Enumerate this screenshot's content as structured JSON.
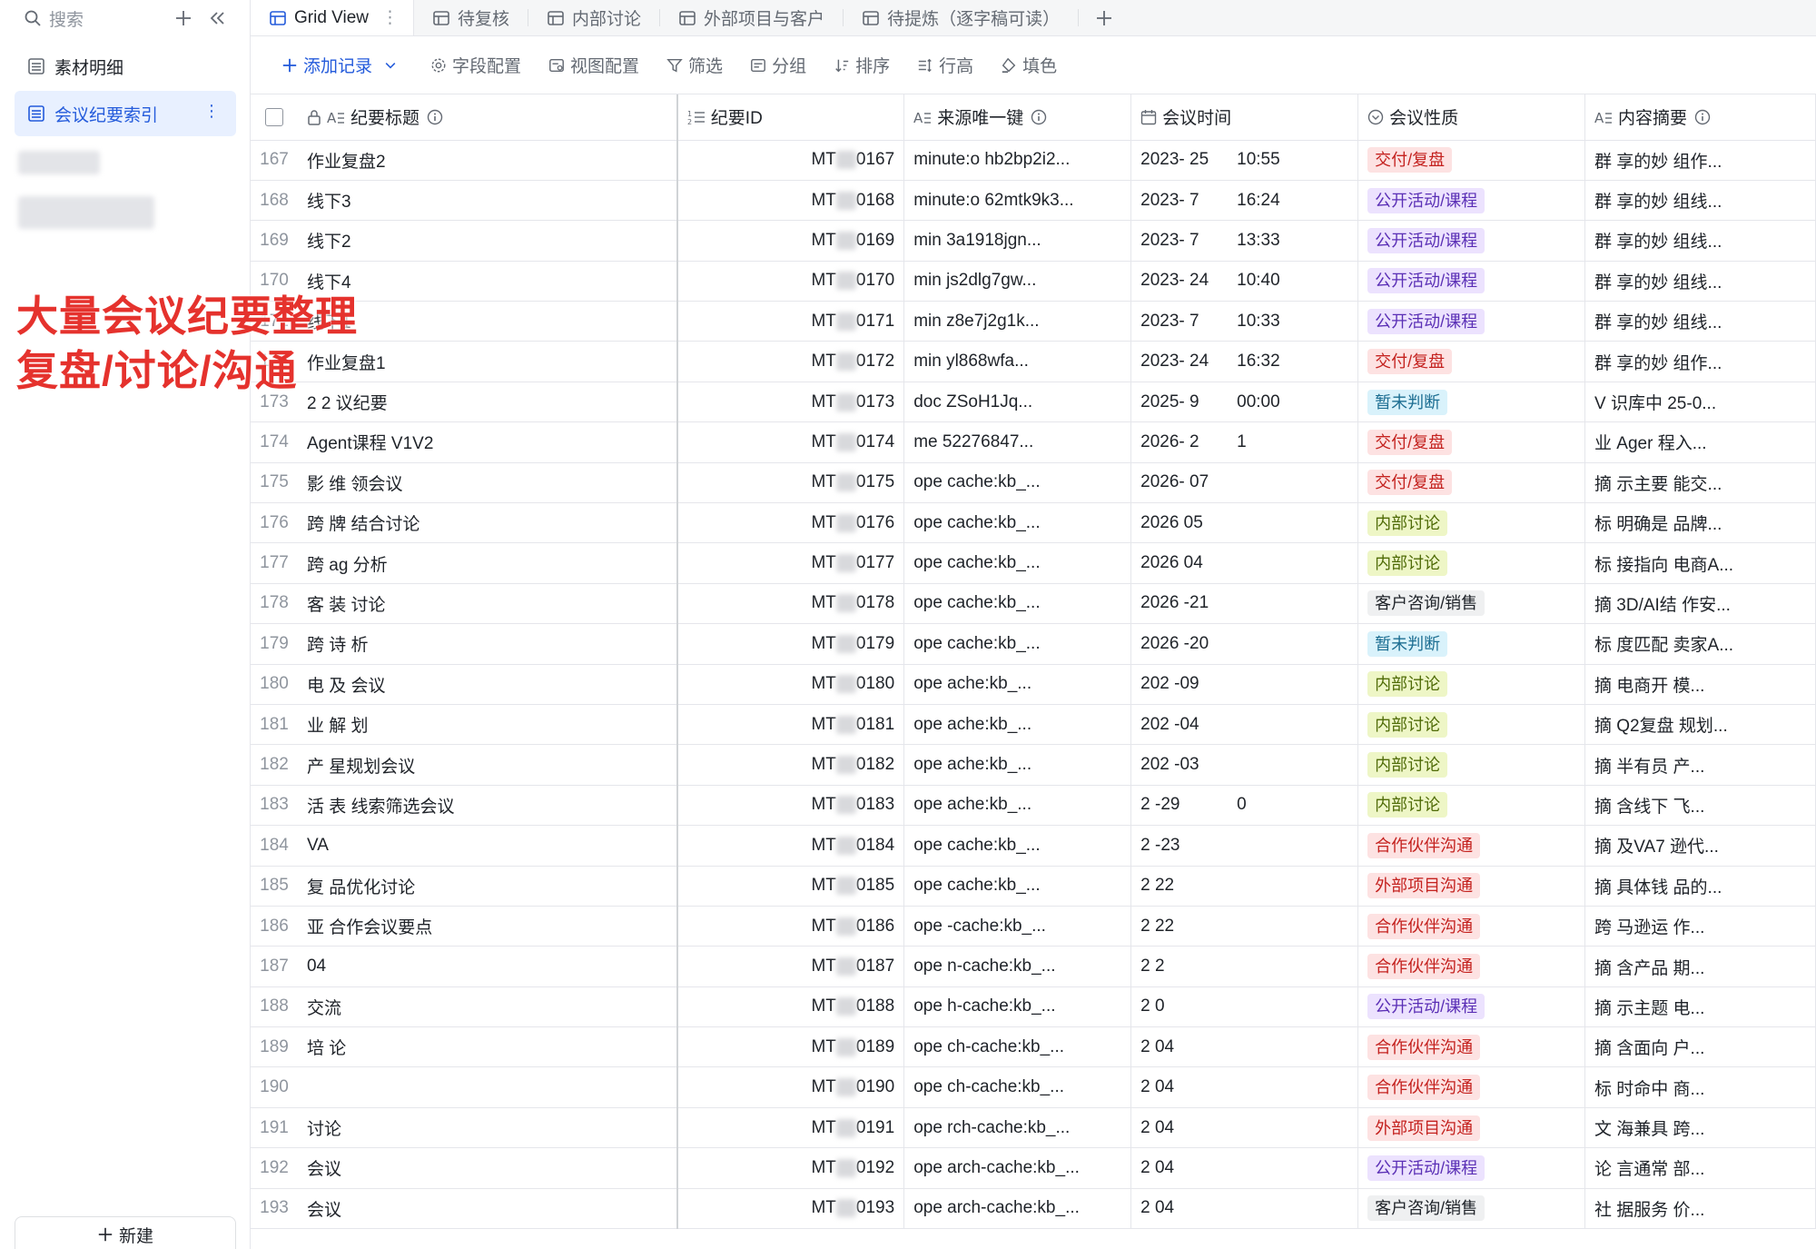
{
  "sidebar": {
    "search_placeholder": "搜索",
    "items": [
      {
        "label": "素材明细"
      },
      {
        "label": "会议纪要索引"
      }
    ],
    "new_label": "新建"
  },
  "overlay": {
    "line1": "大量会议纪要整理",
    "line2": "复盘/讨论/沟通"
  },
  "tabs": [
    {
      "label": "Grid View"
    },
    {
      "label": "待复核"
    },
    {
      "label": "内部讨论"
    },
    {
      "label": "外部项目与客户"
    },
    {
      "label": "待提炼（逐字稿可读）"
    }
  ],
  "toolbar": {
    "add_record": "添加记录",
    "field_config": "字段配置",
    "view_config": "视图配置",
    "filter": "筛选",
    "group": "分组",
    "sort": "排序",
    "row_height": "行高",
    "fill_color": "填色"
  },
  "columns": [
    "纪要标题",
    "纪要ID",
    "来源唯一键",
    "会议时间",
    "会议性质",
    "内容摘要"
  ],
  "tag_colors": {
    "交付/复盘": {
      "bg": "#fde2e2",
      "fg": "#c4221f"
    },
    "公开活动/课程": {
      "bg": "#ece2fe",
      "fg": "#5a2fb5"
    },
    "暂未判断": {
      "bg": "#d9f2fb",
      "fg": "#1d6e92"
    },
    "内部讨论": {
      "bg": "#eef6c6",
      "fg": "#4f6b07"
    },
    "客户咨询/销售": {
      "bg": "#eff0f1",
      "fg": "#1f2329"
    },
    "合作伙伴沟通": {
      "bg": "#fde2e2",
      "fg": "#c4221f"
    },
    "外部项目沟通": {
      "bg": "#fde2e2",
      "fg": "#c4221f"
    }
  },
  "rows": [
    {
      "n": "167",
      "title": "作业复盘2",
      "id": "0167",
      "src": "minute:o hb2bp2i2...",
      "date": "2023-    25",
      "time": "10:55",
      "tag": "交付/复盘",
      "sum": "群   享的妙   组作..."
    },
    {
      "n": "168",
      "title": "线下3",
      "id": "0168",
      "src": "minute:o 62mtk9k3...",
      "date": "2023-    7",
      "time": "16:24",
      "tag": "公开活动/课程",
      "sum": "群   享的妙   组线..."
    },
    {
      "n": "169",
      "title": "线下2",
      "id": "0169",
      "src": "min   3a1918jgn...",
      "date": "2023-    7",
      "time": "13:33",
      "tag": "公开活动/课程",
      "sum": "群   享的妙   组线..."
    },
    {
      "n": "170",
      "title": "线下4",
      "id": "0170",
      "src": "min   js2dlg7gw...",
      "date": "2023-    24",
      "time": "10:40",
      "tag": "公开活动/课程",
      "sum": "群   享的妙   组线..."
    },
    {
      "n": "171",
      "title": "线下1",
      "id": "0171",
      "src": "min   z8e7j2g1k...",
      "date": "2023-    7",
      "time": "10:33",
      "tag": "公开活动/课程",
      "sum": "群   享的妙   组线..."
    },
    {
      "n": "172",
      "title": "作业复盘1",
      "id": "0172",
      "src": "min   yl868wfa...",
      "date": "2023-    24",
      "time": "16:32",
      "tag": "交付/复盘",
      "sum": "群   享的妙   组作..."
    },
    {
      "n": "173",
      "title": "2   2   议纪要",
      "id": "0173",
      "src": "doc   ZSoH1Jq...",
      "date": "2025-    9",
      "time": "00:00",
      "tag": "暂未判断",
      "sum": "V   识库中   25-0..."
    },
    {
      "n": "174",
      "title": "   Agent课程 V1V2",
      "id": "0174",
      "src": "me   52276847...",
      "date": "2026-    2",
      "time": "1   ",
      "tag": "交付/复盘",
      "sum": "   业 Ager   程入..."
    },
    {
      "n": "175",
      "title": "影   维   领会议",
      "id": "0175",
      "src": "ope   cache:kb_...",
      "date": "2026-    07",
      "time": "",
      "tag": "交付/复盘",
      "sum": "摘   示主要   能交..."
    },
    {
      "n": "176",
      "title": "跨   牌   结合讨论",
      "id": "0176",
      "src": "ope   cache:kb_...",
      "date": "2026    05",
      "time": "",
      "tag": "内部讨论",
      "sum": "标   明确是   品牌..."
    },
    {
      "n": "177",
      "title": "跨   ag   分析",
      "id": "0177",
      "src": "ope   cache:kb_...",
      "date": "2026    04",
      "time": "",
      "tag": "内部讨论",
      "sum": "标   接指向   电商A..."
    },
    {
      "n": "178",
      "title": "客   装   讨论",
      "id": "0178",
      "src": "ope   cache:kb_...",
      "date": "2026    -21",
      "time": "",
      "tag": "客户咨询/销售",
      "sum": "摘   3D/AI结   作安..."
    },
    {
      "n": "179",
      "title": "跨   诗   析",
      "id": "0179",
      "src": "ope   cache:kb_...",
      "date": "2026    -20",
      "time": "",
      "tag": "暂未判断",
      "sum": "标   度匹配   卖家A..."
    },
    {
      "n": "180",
      "title": "电   及   会议",
      "id": "0180",
      "src": "ope   ache:kb_...",
      "date": "202    -09",
      "time": "",
      "tag": "内部讨论",
      "sum": "摘   电商开   模..."
    },
    {
      "n": "181",
      "title": "业   解   划",
      "id": "0181",
      "src": "ope   ache:kb_...",
      "date": "202    -04",
      "time": "",
      "tag": "内部讨论",
      "sum": "摘   Q2复盘   规划..."
    },
    {
      "n": "182",
      "title": "产   星规划会议",
      "id": "0182",
      "src": "ope   ache:kb_...",
      "date": "202    -03",
      "time": "",
      "tag": "内部讨论",
      "sum": "摘   半有员   产..."
    },
    {
      "n": "183",
      "title": "活   表   线索筛选会议",
      "id": "0183",
      "src": "ope   ache:kb_...",
      "date": "2    -29",
      "time": "0",
      "tag": "内部讨论",
      "sum": "摘   含线下   飞..."
    },
    {
      "n": "184",
      "title": "VA",
      "id": "0184",
      "src": "ope   cache:kb_...",
      "date": "2    -23",
      "time": "",
      "tag": "合作伙伴沟通",
      "sum": "摘   及VA7   逊代..."
    },
    {
      "n": "185",
      "title": "复   品优化讨论",
      "id": "0185",
      "src": "ope   cache:kb_...",
      "date": "2    22",
      "time": "",
      "tag": "外部项目沟通",
      "sum": "摘   具体钱   品的..."
    },
    {
      "n": "186",
      "title": "亚   合作会议要点",
      "id": "0186",
      "src": "ope   -cache:kb_...",
      "date": "2    22",
      "time": "",
      "tag": "合作伙伴沟通",
      "sum": "跨   马逊运   作..."
    },
    {
      "n": "187",
      "title": "04",
      "id": "0187",
      "src": "ope   n-cache:kb_...",
      "date": "2    2",
      "time": "",
      "tag": "合作伙伴沟通",
      "sum": "摘   含产品   期..."
    },
    {
      "n": "188",
      "title": "   交流",
      "id": "0188",
      "src": "ope   h-cache:kb_...",
      "date": "2    0",
      "time": "",
      "tag": "公开活动/课程",
      "sum": "摘   示主题   电..."
    },
    {
      "n": "189",
      "title": "   培   论",
      "id": "0189",
      "src": "ope   ch-cache:kb_...",
      "date": "2    04",
      "time": "",
      "tag": "合作伙伴沟通",
      "sum": "摘   含面向   户..."
    },
    {
      "n": "190",
      "title": "",
      "id": "0190",
      "src": "ope   ch-cache:kb_...",
      "date": "2    04",
      "time": "",
      "tag": "合作伙伴沟通",
      "sum": "标   时命中   商..."
    },
    {
      "n": "191",
      "title": "   讨论",
      "id": "0191",
      "src": "ope   rch-cache:kb_...",
      "date": "2    04",
      "time": "",
      "tag": "外部项目沟通",
      "sum": "文   海兼具   跨..."
    },
    {
      "n": "192",
      "title": "   会议",
      "id": "0192",
      "src": "ope   arch-cache:kb_...",
      "date": "2    04",
      "time": "",
      "tag": "公开活动/课程",
      "sum": "论   言通常   部..."
    },
    {
      "n": "193",
      "title": "   会议",
      "id": "0193",
      "src": "ope   arch-cache:kb_...",
      "date": "2    04",
      "time": "",
      "tag": "客户咨询/销售",
      "sum": "社   据服务   价..."
    }
  ]
}
